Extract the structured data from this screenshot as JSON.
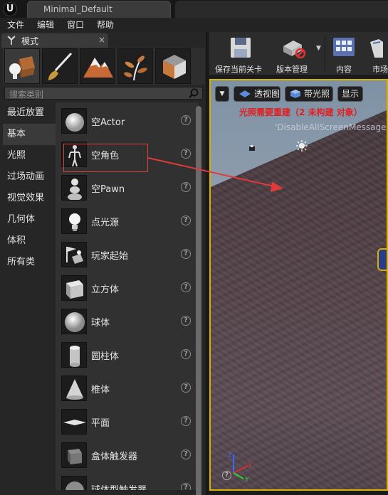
{
  "window": {
    "tab_title": "Minimal_Default"
  },
  "menu": {
    "items": [
      "文件",
      "编辑",
      "窗口",
      "帮助"
    ]
  },
  "modes": {
    "tab_label": "模式",
    "close": "×",
    "mode_icons": [
      "place-mode-icon",
      "paint-mode-icon",
      "landscape-mode-icon",
      "foliage-mode-icon",
      "geometry-mode-icon"
    ],
    "search_placeholder": "搜索类别",
    "categories": [
      "最近放置",
      "基本",
      "光照",
      "过场动画",
      "视觉效果",
      "几何体",
      "体积",
      "所有类"
    ],
    "active_category": "基本",
    "assets": [
      {
        "label": "空Actor",
        "icon": "sphere-white-icon"
      },
      {
        "label": "空角色",
        "icon": "character-figure-icon"
      },
      {
        "label": "空Pawn",
        "icon": "pawn-icon"
      },
      {
        "label": "点光源",
        "icon": "light-bulb-icon"
      },
      {
        "label": "玩家起始",
        "icon": "player-start-icon"
      },
      {
        "label": "立方体",
        "icon": "cube-icon"
      },
      {
        "label": "球体",
        "icon": "sphere-icon"
      },
      {
        "label": "圆柱体",
        "icon": "cylinder-icon"
      },
      {
        "label": "椎体",
        "icon": "cone-icon"
      },
      {
        "label": "平面",
        "icon": "plane-icon"
      },
      {
        "label": "盒体触发器",
        "icon": "box-trigger-icon"
      },
      {
        "label": "球体型触发器",
        "icon": "sphere-trigger-icon"
      }
    ],
    "help": "?"
  },
  "toolbar": {
    "buttons": [
      {
        "label": "保存当前关卡",
        "icon": "save-icon"
      },
      {
        "label": "版本管理",
        "icon": "source-control-icon"
      },
      {
        "label": "内容",
        "icon": "content-browser-icon"
      },
      {
        "label": "市场",
        "icon": "marketplace-icon"
      }
    ]
  },
  "viewport": {
    "perspective": "透视图",
    "lit": "带光照",
    "show": "显示",
    "warning": "光照需要重建（2 未构建 对象）",
    "message": "'DisableAllScreenMessages'",
    "axes": {
      "x": "X",
      "y": "Y",
      "z": "Z"
    },
    "colors": {
      "warning": "#e02020",
      "selection_border": "#d6b300",
      "annotation": "#d84040"
    }
  }
}
